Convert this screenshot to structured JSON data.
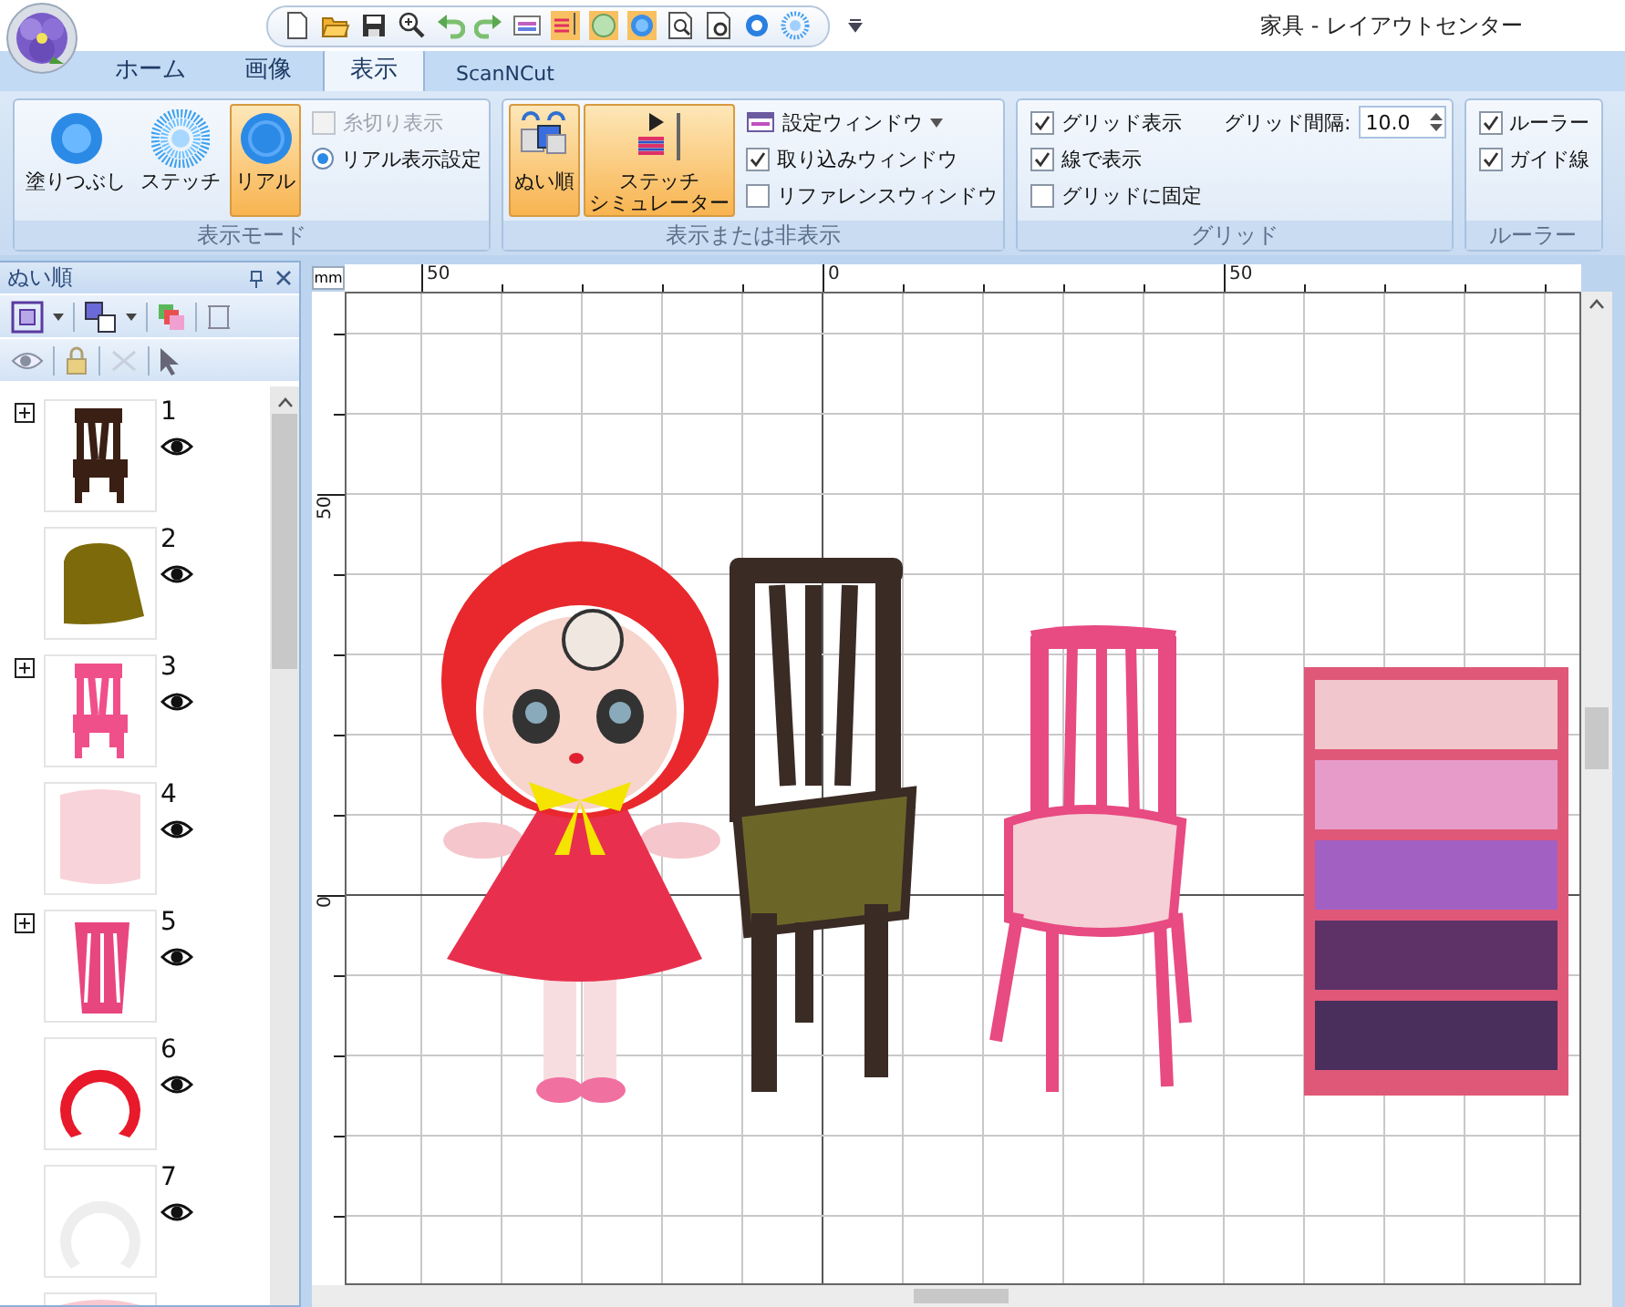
{
  "window": {
    "title": "家具 - レイアウトセンター"
  },
  "tabs": [
    {
      "label": "ホーム",
      "selected": false
    },
    {
      "label": "画像",
      "selected": false
    },
    {
      "label": "表示",
      "selected": true
    },
    {
      "label": "ScanNCut",
      "selected": false
    }
  ],
  "ribbon": {
    "groups": [
      {
        "title": "表示モード",
        "buttons": [
          {
            "label": "塗りつぶし",
            "selected": false
          },
          {
            "label": "ステッチ",
            "selected": false
          },
          {
            "label": "リアル",
            "selected": true
          }
        ],
        "options": [
          {
            "kind": "check",
            "label": "糸切り表示",
            "checked": false,
            "disabled": true
          },
          {
            "kind": "radio",
            "label": "リアル表示設定",
            "selected": true
          }
        ]
      },
      {
        "title": "表示または非表示",
        "buttons": [
          {
            "label": "ぬい順",
            "selected": true
          },
          {
            "lines": [
              "ステッチ",
              "シミュレーター"
            ],
            "selected": true
          }
        ],
        "options": [
          {
            "kind": "dropdown",
            "label": "設定ウィンドウ"
          },
          {
            "kind": "check",
            "label": "取り込みウィンドウ",
            "checked": true,
            "disabled": false
          },
          {
            "kind": "check",
            "label": "リファレンスウィンドウ",
            "checked": false,
            "disabled": false
          }
        ]
      },
      {
        "title": "グリッド",
        "options": [
          {
            "kind": "check",
            "label": "グリッド表示",
            "checked": true,
            "disabled": false
          },
          {
            "kind": "check",
            "label": "線で表示",
            "checked": true,
            "disabled": false
          },
          {
            "kind": "check",
            "label": "グリッドに固定",
            "checked": false,
            "disabled": false
          },
          {
            "kind": "spin",
            "label": "グリッド間隔:",
            "value": "10.0"
          }
        ]
      },
      {
        "title": "ルーラー",
        "options": [
          {
            "kind": "check",
            "label": "ルーラー",
            "checked": true,
            "disabled": false
          },
          {
            "kind": "check",
            "label": "ガイド線",
            "checked": true,
            "disabled": false
          }
        ]
      }
    ]
  },
  "panel": {
    "title": "ぬい順",
    "items": [
      {
        "number": "1",
        "expandable": true,
        "kind": "chair",
        "color": "#3a1f14"
      },
      {
        "number": "2",
        "expandable": false,
        "kind": "seat",
        "color": "#7d6a0a"
      },
      {
        "number": "3",
        "expandable": true,
        "kind": "chair",
        "color": "#f0508a"
      },
      {
        "number": "4",
        "expandable": false,
        "kind": "cushion",
        "color": "#f9d3da"
      },
      {
        "number": "5",
        "expandable": true,
        "kind": "backrest",
        "color": "#e8467e"
      },
      {
        "number": "6",
        "expandable": false,
        "kind": "arc",
        "color": "#e8192a"
      },
      {
        "number": "7",
        "expandable": false,
        "kind": "ring",
        "color": "#eeeeee"
      },
      {
        "expandable": false,
        "kind": "cushion",
        "color": "#f8c8d0"
      }
    ]
  },
  "ruler": {
    "unit": "mm",
    "x_labels": [
      "50",
      "0",
      "50"
    ],
    "y_labels": [
      "50",
      "0"
    ]
  }
}
